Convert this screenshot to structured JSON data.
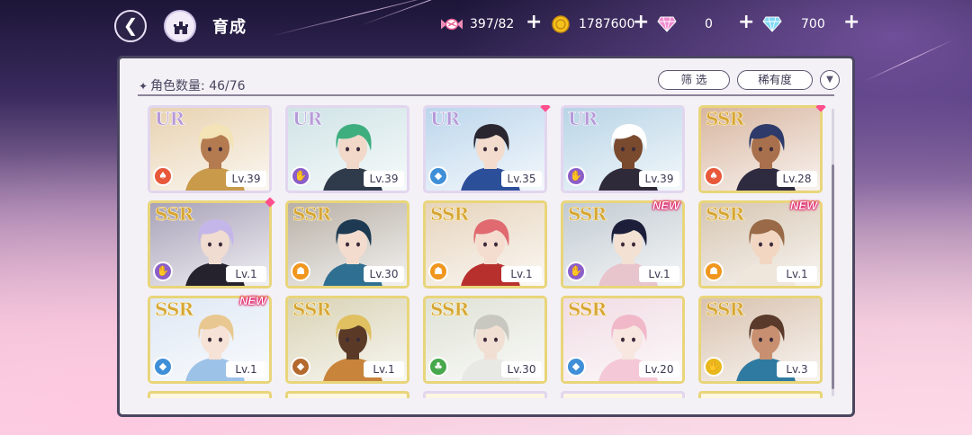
{
  "header": {
    "back_icon": "back-arrow-sparkle-icon",
    "home_icon": "castle-home-icon",
    "title": "育成"
  },
  "resources": [
    {
      "id": "candy",
      "icon": "candy-icon",
      "value": "397/82"
    },
    {
      "id": "coin",
      "icon": "gold-coin-icon",
      "value": "1787600"
    },
    {
      "id": "pink-gem",
      "icon": "pink-diamond-icon",
      "value": "0"
    },
    {
      "id": "blue-gem",
      "icon": "blue-diamond-icon",
      "value": "700"
    }
  ],
  "panel": {
    "count_label": "角色数量:",
    "count_value": "46/76",
    "filter_label": "筛 选",
    "sort_label": "稀有度"
  },
  "attributes": {
    "fire": {
      "color": "#e8583a",
      "glyph": "♠"
    },
    "purple": {
      "color": "#8b5ec8",
      "glyph": "✋"
    },
    "blue": {
      "color": "#3f8fd8",
      "glyph": "◆"
    },
    "orange": {
      "color": "#f0961e",
      "glyph": "☗"
    },
    "brown": {
      "color": "#b46a2e",
      "glyph": "◆"
    },
    "green": {
      "color": "#48a84c",
      "glyph": "♣"
    },
    "yellow": {
      "color": "#e8b81c",
      "glyph": "✋"
    }
  },
  "cards": [
    {
      "rarity": "UR",
      "level": "Lv.39",
      "attr": "fire",
      "bg": "#e8d2b0",
      "hair": "#f3e3b6",
      "skin": "#b47a50",
      "outfit": "#c89a4a",
      "new": false,
      "mark": false
    },
    {
      "rarity": "UR",
      "level": "Lv.39",
      "attr": "purple",
      "bg": "#cfe3e6",
      "hair": "#3fae7f",
      "skin": "#f1d8c8",
      "outfit": "#2f3a4a",
      "new": false,
      "mark": false
    },
    {
      "rarity": "UR",
      "level": "Lv.35",
      "attr": "blue",
      "bg": "#bcd6ec",
      "hair": "#2a2630",
      "skin": "#f3dccd",
      "outfit": "#2c4f9a",
      "new": false,
      "mark": true
    },
    {
      "rarity": "UR",
      "level": "Lv.39",
      "attr": "purple",
      "bg": "#b8d4e6",
      "hair": "#ffffff",
      "skin": "#7a4a2e",
      "outfit": "#2e2a3a",
      "new": false,
      "mark": false
    },
    {
      "rarity": "SSR",
      "level": "Lv.28",
      "attr": "fire",
      "bg": "#d8b6a0",
      "hair": "#2d3a6a",
      "skin": "#a8704c",
      "outfit": "#2e2a40",
      "new": false,
      "mark": true
    },
    {
      "rarity": "SSR",
      "level": "Lv.1",
      "attr": "purple",
      "bg": "#a8a2b8",
      "hair": "#c5b6ea",
      "skin": "#f1dcd2",
      "outfit": "#25222e",
      "new": false,
      "mark": true
    },
    {
      "rarity": "SSR",
      "level": "Lv.30",
      "attr": "orange",
      "bg": "#b8b0a6",
      "hair": "#1e3a52",
      "skin": "#f3dccd",
      "outfit": "#2f6f92",
      "new": false,
      "mark": false
    },
    {
      "rarity": "SSR",
      "level": "Lv.1",
      "attr": "orange",
      "bg": "#e6d4bc",
      "hair": "#e06a70",
      "skin": "#f4dccf",
      "outfit": "#b8302e",
      "new": false,
      "mark": false
    },
    {
      "rarity": "SSR",
      "level": "Lv.1",
      "attr": "purple",
      "bg": "#c2cbd2",
      "hair": "#1c1e3a",
      "skin": "#f3e1d4",
      "outfit": "#e8c4cc",
      "new": true,
      "mark": false
    },
    {
      "rarity": "SSR",
      "level": "Lv.1",
      "attr": "orange",
      "bg": "#d6c6b2",
      "hair": "#9a6a48",
      "skin": "#f2d6c2",
      "outfit": "#efe6dc",
      "new": true,
      "mark": false
    },
    {
      "rarity": "SSR",
      "level": "Lv.1",
      "attr": "blue",
      "bg": "#dfe8f4",
      "hair": "#e8c890",
      "skin": "#f6e2d6",
      "outfit": "#9cc2e8",
      "new": true,
      "mark": false
    },
    {
      "rarity": "SSR",
      "level": "Lv.1",
      "attr": "brown",
      "bg": "#d8d2b4",
      "hair": "#e0c060",
      "skin": "#5a3a26",
      "outfit": "#c8843a",
      "new": false,
      "mark": false
    },
    {
      "rarity": "SSR",
      "level": "Lv.30",
      "attr": "green",
      "bg": "#dfe2d6",
      "hair": "#c8c8c0",
      "skin": "#f1dfd4",
      "outfit": "#e8e8e4",
      "new": false,
      "mark": false
    },
    {
      "rarity": "SSR",
      "level": "Lv.20",
      "attr": "blue",
      "bg": "#f0dce4",
      "hair": "#f0b8c8",
      "skin": "#f8e6e0",
      "outfit": "#f4c8d6",
      "new": false,
      "mark": false
    },
    {
      "rarity": "SSR",
      "level": "Lv.3",
      "attr": "yellow",
      "bg": "#d8c2ae",
      "hair": "#5a3a2a",
      "skin": "#c89070",
      "outfit": "#2f7aa0",
      "new": false,
      "mark": false
    }
  ]
}
